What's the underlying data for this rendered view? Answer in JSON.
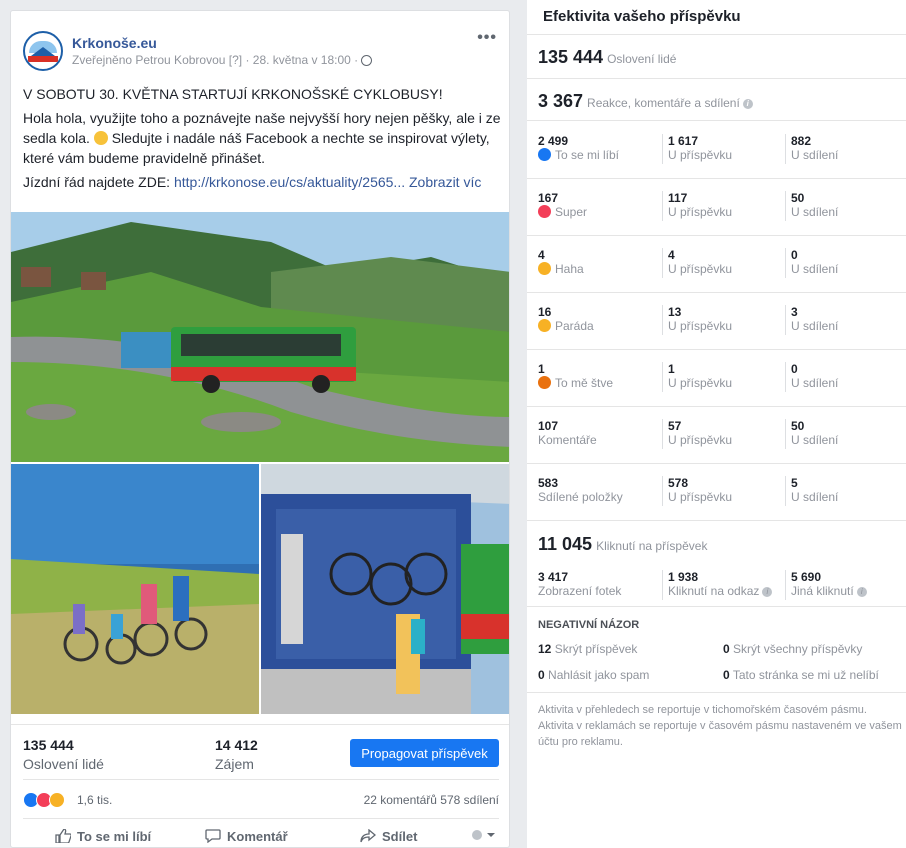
{
  "post": {
    "page_name": "Krkonoše.eu",
    "meta": "Zveřejněno Petrou Kobrovou [?] · 28. května v 18:00 ·",
    "more": "•••",
    "headline": "V SOBOTU 30. KVĚTNA STARTUJÍ KRKONOŠSKÉ CYKLOBUSY!",
    "body1": "Hola hola, využijte toho a poznávejte naše nejvyšší hory nejen pěšky, ale i ze sedla kola.",
    "body2": "Sledujte i nadále náš Facebook a nechte se inspirovat výlety, které vám budeme pravidelně přinášet.",
    "body3_prefix": "Jízdní řád najdete ZDE:",
    "link": "http://krkonose.eu/cs/aktuality/2565...",
    "see_more": "Zobrazit víc",
    "stats": {
      "reach_value": "135 444",
      "reach_label": "Oslovení lidé",
      "engagement_value": "14 412",
      "engagement_label": "Zájem",
      "promote_button": "Propagovat příspěvek"
    },
    "reactions_count": "1,6 tis.",
    "comments_shares": "22 komentářů  578 sdílení",
    "actions": {
      "like": "To se mi líbí",
      "comment": "Komentář",
      "share": "Sdílet"
    }
  },
  "panel": {
    "title": "Efektivita vašeho příspěvku",
    "reach_value": "135 444",
    "reach_label": "Oslovení lidé",
    "engagement_value": "3 367",
    "engagement_label": "Reakce, komentáře a sdílení",
    "rows": [
      {
        "total": "2 499",
        "label": "To se mi líbí",
        "post": "1 617",
        "post_label": "U příspěvku",
        "share": "882",
        "share_label": "U sdílení",
        "icon": "like-icon",
        "color": "#1877f2"
      },
      {
        "total": "167",
        "label": "Super",
        "post": "117",
        "post_label": "U příspěvku",
        "share": "50",
        "share_label": "U sdílení",
        "icon": "love-icon",
        "color": "#f33e58"
      },
      {
        "total": "4",
        "label": "Haha",
        "post": "4",
        "post_label": "U příspěvku",
        "share": "0",
        "share_label": "U sdílení",
        "icon": "haha-icon",
        "color": "#f7b125"
      },
      {
        "total": "16",
        "label": "Paráda",
        "post": "13",
        "post_label": "U příspěvku",
        "share": "3",
        "share_label": "U sdílení",
        "icon": "wow-icon",
        "color": "#f7b125"
      },
      {
        "total": "1",
        "label": "To mě štve",
        "post": "1",
        "post_label": "U příspěvku",
        "share": "0",
        "share_label": "U sdílení",
        "icon": "angry-icon",
        "color": "#e9710f"
      },
      {
        "total": "107",
        "label": "Komentáře",
        "post": "57",
        "post_label": "U příspěvku",
        "share": "50",
        "share_label": "U sdílení",
        "icon": "",
        "color": ""
      },
      {
        "total": "583",
        "label": "Sdílené položky",
        "post": "578",
        "post_label": "U příspěvku",
        "share": "5",
        "share_label": "U sdílení",
        "icon": "",
        "color": ""
      }
    ],
    "clicks_value": "11 045",
    "clicks_label": "Kliknutí na příspěvek",
    "click_breakdown": [
      {
        "value": "3 417",
        "label": "Zobrazení fotek"
      },
      {
        "value": "1 938",
        "label": "Kliknutí na odkaz"
      },
      {
        "value": "5 690",
        "label": "Jiná kliknutí"
      }
    ],
    "negative_title": "NEGATIVNÍ NÁZOR",
    "negative": [
      {
        "value": "12",
        "label": "Skrýt příspěvek"
      },
      {
        "value": "0",
        "label": "Skrýt všechny příspěvky"
      },
      {
        "value": "0",
        "label": "Nahlásit jako spam"
      },
      {
        "value": "0",
        "label": "Tato stránka se mi už nelíbí"
      }
    ],
    "footnote": "Aktivita v přehledech se reportuje v tichomořském časovém pásmu. Aktivita v reklamách se reportuje v časovém pásmu nastaveném ve vašem účtu pro reklamu."
  }
}
